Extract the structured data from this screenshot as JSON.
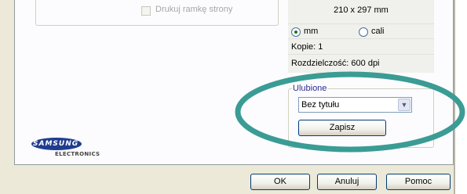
{
  "print_frame": {
    "label": "Drukuj ramkę strony",
    "checked": false
  },
  "summary": {
    "paper_size": "210 x 297 mm",
    "units": {
      "options": [
        "mm",
        "cali"
      ],
      "selected": "mm"
    },
    "copies": "Kopie: 1",
    "resolution_partial": "Rozdzielczość: 600 dpi"
  },
  "favorites": {
    "legend": "Ulubione",
    "selected_value": "Bez tytułu",
    "save_label": "Zapisz"
  },
  "brand": {
    "name": "SAMSUNG",
    "sub": "ELECTRONICS"
  },
  "footer": {
    "ok_label": "OK",
    "cancel_label": "Anuluj",
    "help_label": "Pomoc"
  },
  "colors": {
    "highlight_ellipse": "#3a9c94",
    "dialog_bg": "#ece9d8",
    "brand_blue": "#1f3d8f"
  }
}
